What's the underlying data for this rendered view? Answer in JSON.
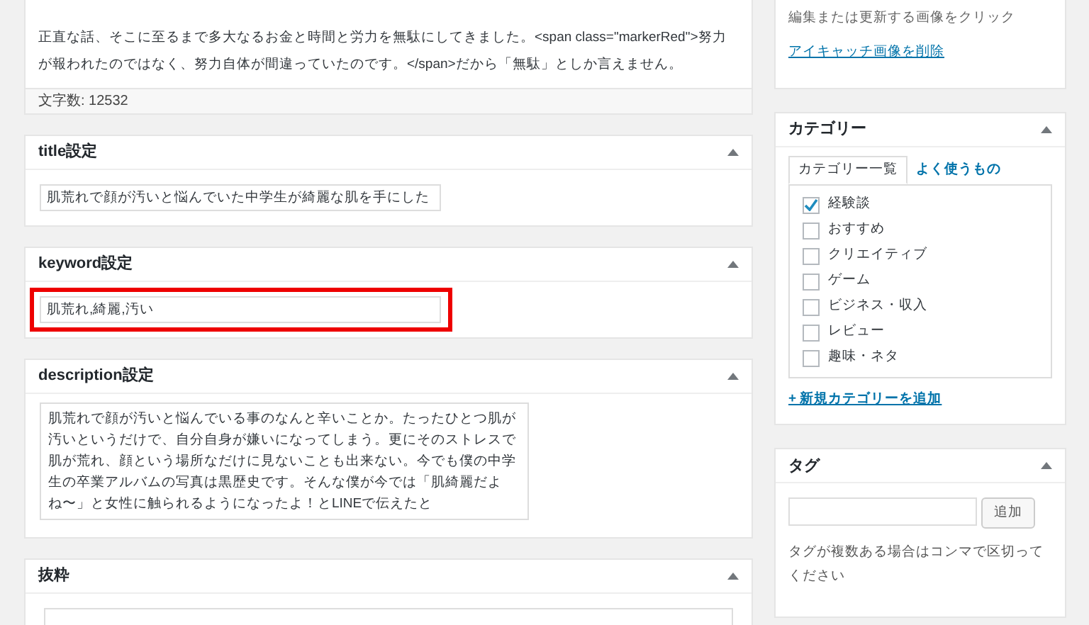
{
  "editor": {
    "paragraph": "正直な話、そこに至るまで多大なるお金と時間と労力を無駄にしてきました。<span class=\"markerRed\">努力が報われたのではなく、努力自体が間違っていたのです。</span>だから「無駄」としか言えません。",
    "word_count": "文字数: 12532"
  },
  "boxes": [
    {
      "kind": "input",
      "title": "title設定",
      "value": "肌荒れで顔が汚いと悩んでいた中学生が綺麗な肌を手にした"
    },
    {
      "kind": "input",
      "title": "keyword設定",
      "value": "肌荒れ,綺麗,汚い",
      "highlighted": true
    },
    {
      "kind": "textarea",
      "title": "description設定",
      "lines": [
        "肌荒れで顔が汚いと悩んでいる事のなんと辛いことか。たったひとつ肌が",
        "汚いというだけで、自分自身が嫌いになってしまう。更にそのストレスで",
        "肌が荒れ、顔という場所なだけに見ないことも出来ない。今でも僕の中学",
        "生の卒業アルバムの写真は黒歴史です。そんな僕が今では「肌綺麗だよ",
        "ね〜」と女性に触られるようになったよ！とLINEで伝えたと"
      ]
    },
    {
      "kind": "empty",
      "title": "抜粋"
    }
  ],
  "thumbnail": {
    "hint": "編集または更新する画像をクリック",
    "remove_link": "アイキャッチ画像を削除"
  },
  "categories": {
    "title": "カテゴリー",
    "tabs": [
      {
        "label": "カテゴリー一覧",
        "selected": true
      },
      {
        "label": "よく使うもの",
        "selected": false
      }
    ],
    "items": [
      {
        "label": "経験談",
        "checked": true
      },
      {
        "label": "おすすめ",
        "checked": false
      },
      {
        "label": "クリエイティブ",
        "checked": false
      },
      {
        "label": "ゲーム",
        "checked": false
      },
      {
        "label": "ビジネス・収入",
        "checked": false
      },
      {
        "label": "レビュー",
        "checked": false
      },
      {
        "label": "趣味・ネタ",
        "checked": false
      }
    ],
    "add_link": "+ 新規カテゴリーを追加"
  },
  "tags": {
    "title": "タグ",
    "button": "追加",
    "hint": "タグが複数ある場合はコンマで区切ってください"
  }
}
